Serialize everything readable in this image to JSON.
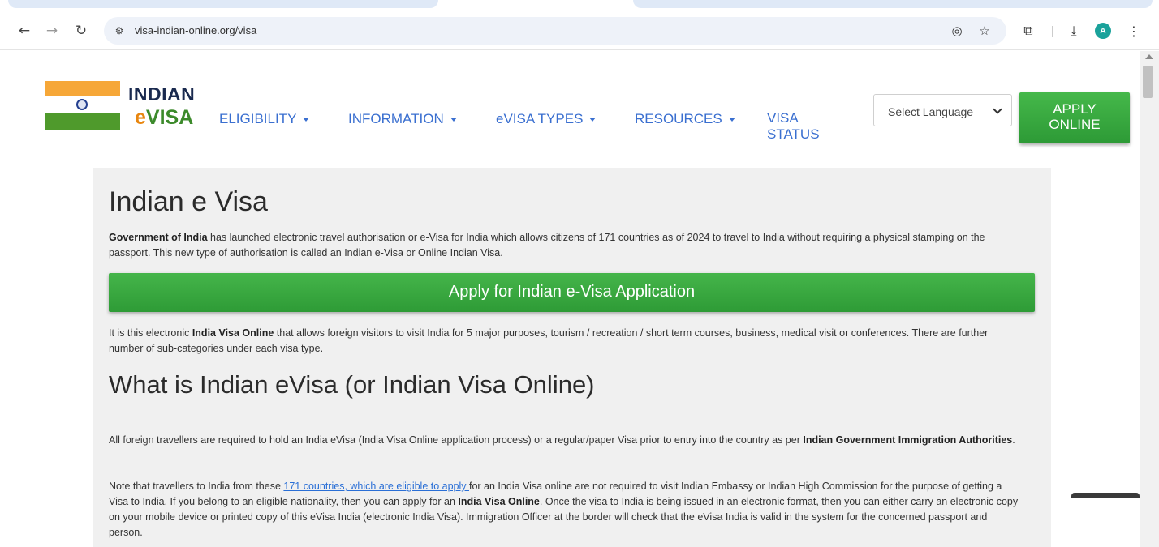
{
  "browser": {
    "url": "visa-indian-online.org/visa",
    "avatar_letter": "A",
    "icons": [
      "back-icon",
      "forward-icon",
      "reload-icon",
      "site-info-icon",
      "eye-off-icon",
      "star-icon",
      "extensions-icon",
      "download-icon",
      "avatar-icon",
      "more-icon"
    ]
  },
  "header": {
    "logo_top": "INDIAN",
    "logo_e": "e",
    "logo_visa": "VISA",
    "nav": {
      "eligibility": "ELIGIBILITY",
      "information": "INFORMATION",
      "evisa_types": "eVISA TYPES",
      "resources": "RESOURCES",
      "visa_status_line1": "VISA",
      "visa_status_line2": "STATUS"
    },
    "language_select": "Select Language",
    "apply_online": "APPLY\nONLINE"
  },
  "main": {
    "title": "Indian e Visa",
    "intro_bold": "Government of India",
    "intro_text": " has launched electronic travel authorisation or e-Visa for India which allows citizens of 171 countries as of 2024 to travel to India without requiring a physical stamping on the passport. This new type of authorisation is called an Indian e-Visa or Online Indian Visa.",
    "apply_button": "Apply for Indian e-Visa Application",
    "para2_pre": "It is this electronic ",
    "para2_bold": "India Visa Online",
    "para2_post": " that allows foreign visitors to visit India for 5 major purposes, tourism / recreation / short term courses, business, medical visit or conferences. There are further number of sub-categories under each visa type.",
    "subtitle": "What is Indian eVisa (or Indian Visa Online)",
    "para3_pre": "All foreign travellers are required to hold an India eVisa (India Visa Online application process) or a regular/paper Visa prior to entry into the country as per ",
    "para3_bold": "Indian Government Immigration Authorities",
    "para3_post": ".",
    "para4_pre": "Note that travellers to India from these ",
    "para4_link": "171 countries, which are eligible to apply ",
    "para4_mid": "for an India Visa online are not required to visit Indian Embassy or Indian High Commission for the purpose of getting a Visa to India. If you belong to an eligible nationality, then you can apply for an ",
    "para4_bold": "India Visa Online",
    "para4_post": ". Once the visa to India is being issued in an electronic format, then you can either carry an electronic copy on your mobile device or printed copy of this eVisa India (electronic India Visa). Immigration Officer at the border will check that the eVisa India is valid in the system for the concerned passport and person."
  },
  "colors": {
    "nav_link": "#3a6fd0",
    "apply_green": "#3aa83f",
    "content_bg": "#f0f0f0",
    "flag_saffron": "#f6a738",
    "flag_green": "#4f9a2c"
  }
}
